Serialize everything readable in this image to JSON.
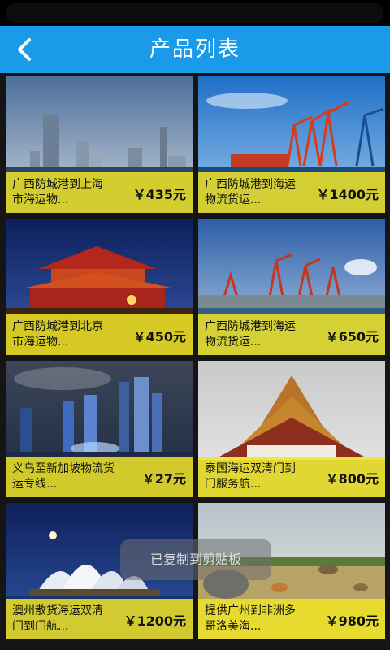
{
  "header": {
    "title": "产品列表",
    "back_icon": "chevron-left-icon"
  },
  "products": [
    {
      "name_line1": "广西防城港到上海",
      "name_line2": "市海运物...",
      "price": "￥435元"
    },
    {
      "name_line1": "广西防城港到海运",
      "name_line2": "物流货运...",
      "price": "￥1400元"
    },
    {
      "name_line1": "广西防城港到北京",
      "name_line2": "市海运物...",
      "price": "￥450元"
    },
    {
      "name_line1": "广西防城港到海运",
      "name_line2": "物流货运...",
      "price": "￥650元"
    },
    {
      "name_line1": "义乌至新加坡物流货",
      "name_line2": "运专线...",
      "price": "￥27元"
    },
    {
      "name_line1": "泰国海运双清门到",
      "name_line2": "门服务航...",
      "price": "￥800元"
    },
    {
      "name_line1": "澳州散货海运双清",
      "name_line2": "门到门航...",
      "price": "￥1200元"
    },
    {
      "name_line1": "提供广州到非洲多",
      "name_line2": "哥洛美海...",
      "price": "￥980元"
    }
  ],
  "toast": "已复制到剪贴板",
  "colors": {
    "header": "#1a9be9",
    "caption": "#f0e428"
  }
}
